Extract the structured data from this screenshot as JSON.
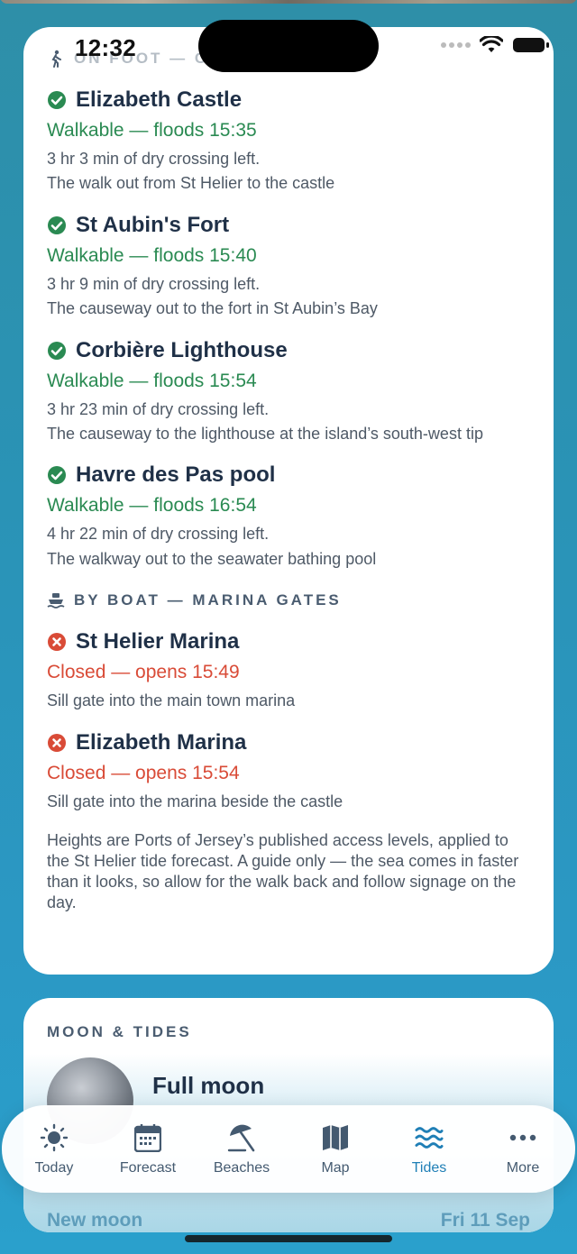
{
  "status_bar": {
    "time": "12:32"
  },
  "on_foot": {
    "header": "ON FOOT — CAUSEWAYS",
    "items": [
      {
        "title": "Elizabeth Castle",
        "status": "Walkable — floods 15:35",
        "meta": "3 hr 3 min of dry crossing left.",
        "desc": "The walk out from St Helier to the castle",
        "state": "ok"
      },
      {
        "title": "St Aubin's Fort",
        "status": "Walkable — floods 15:40",
        "meta": "3 hr 9 min of dry crossing left.",
        "desc": "The causeway out to the fort in St Aubin’s Bay",
        "state": "ok"
      },
      {
        "title": "Corbière Lighthouse",
        "status": "Walkable — floods 15:54",
        "meta": "3 hr 23 min of dry crossing left.",
        "desc": "The causeway to the lighthouse at the island’s south-west tip",
        "state": "ok"
      },
      {
        "title": "Havre des Pas pool",
        "status": "Walkable — floods 16:54",
        "meta": "4 hr 22 min of dry crossing left.",
        "desc": "The walkway out to the seawater bathing pool",
        "state": "ok"
      }
    ]
  },
  "by_boat": {
    "header": "BY BOAT — MARINA GATES",
    "items": [
      {
        "title": "St Helier Marina",
        "status": "Closed — opens 15:49",
        "desc": "Sill gate into the main town marina",
        "state": "closed"
      },
      {
        "title": "Elizabeth Marina",
        "status": "Closed — opens 15:54",
        "desc": "Sill gate into the marina beside the castle",
        "state": "closed"
      }
    ]
  },
  "footnote": "Heights are Ports of Jersey’s published access levels, applied to the St Helier tide forecast. A guide only — the sea comes in faster than it looks, so allow for the walk back and follow signage on the day.",
  "moon": {
    "header": "MOON & TIDES",
    "phase": "Full moon",
    "next_label": "New moon",
    "next_date": "Fri 11 Sep"
  },
  "tabs": [
    {
      "label": "Today",
      "icon": "sun-icon"
    },
    {
      "label": "Forecast",
      "icon": "calendar-icon"
    },
    {
      "label": "Beaches",
      "icon": "umbrella-icon"
    },
    {
      "label": "Map",
      "icon": "map-icon"
    },
    {
      "label": "Tides",
      "icon": "waves-icon",
      "active": true
    },
    {
      "label": "More",
      "icon": "more-icon"
    }
  ],
  "colors": {
    "ok": "#2a8a52",
    "closed": "#d94b37",
    "accent": "#1f7fb6",
    "title": "#1f3047"
  }
}
